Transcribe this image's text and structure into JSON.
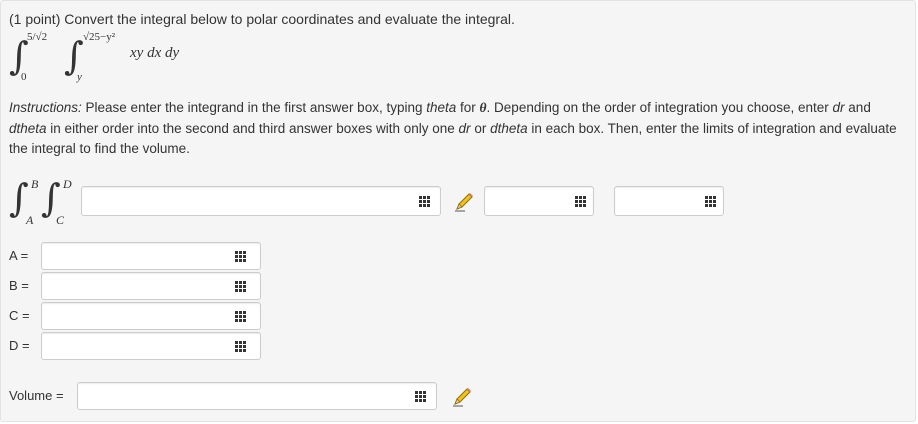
{
  "problem": {
    "points": "(1 point)",
    "text": "Convert the integral below to polar coordinates and evaluate the integral.",
    "outer_upper": "5/√2",
    "outer_lower": "0",
    "inner_upper": "√25−y²",
    "inner_lower": "y",
    "integrand": "xy dx dy"
  },
  "instructions": {
    "heading": "Instructions:",
    "p1": " Please enter the integrand in the first answer box, typing ",
    "t_theta": "theta",
    "p2": " for ",
    "t_symbol": "θ",
    "p3": ". Depending on the order of integration you choose, enter ",
    "t_dr1": "dr",
    "p4": " and ",
    "t_dtheta1": "dtheta",
    "p5": " in either order into the second and third answer boxes with only one ",
    "t_dr2": "dr",
    "p6": " or ",
    "t_dtheta2": "dtheta",
    "p7": " in each box. Then, enter the limits of integration and evaluate the integral to find the volume."
  },
  "answer_integral": {
    "upper_outer": "B",
    "lower_outer": "A",
    "upper_inner": "D",
    "lower_inner": "C"
  },
  "limits": {
    "a": "A =",
    "b": "B =",
    "c": "C =",
    "d": "D ="
  },
  "volume": {
    "label": "Volume ="
  },
  "icons": {
    "matrix": "matrix-icon",
    "pencil": "pencil-icon"
  },
  "colors": {
    "panel_background": "#f5f5f5",
    "panel_border": "#e3e3e3",
    "input_border": "#cccccc",
    "text": "#333333",
    "pencil": "#f2c21b"
  }
}
